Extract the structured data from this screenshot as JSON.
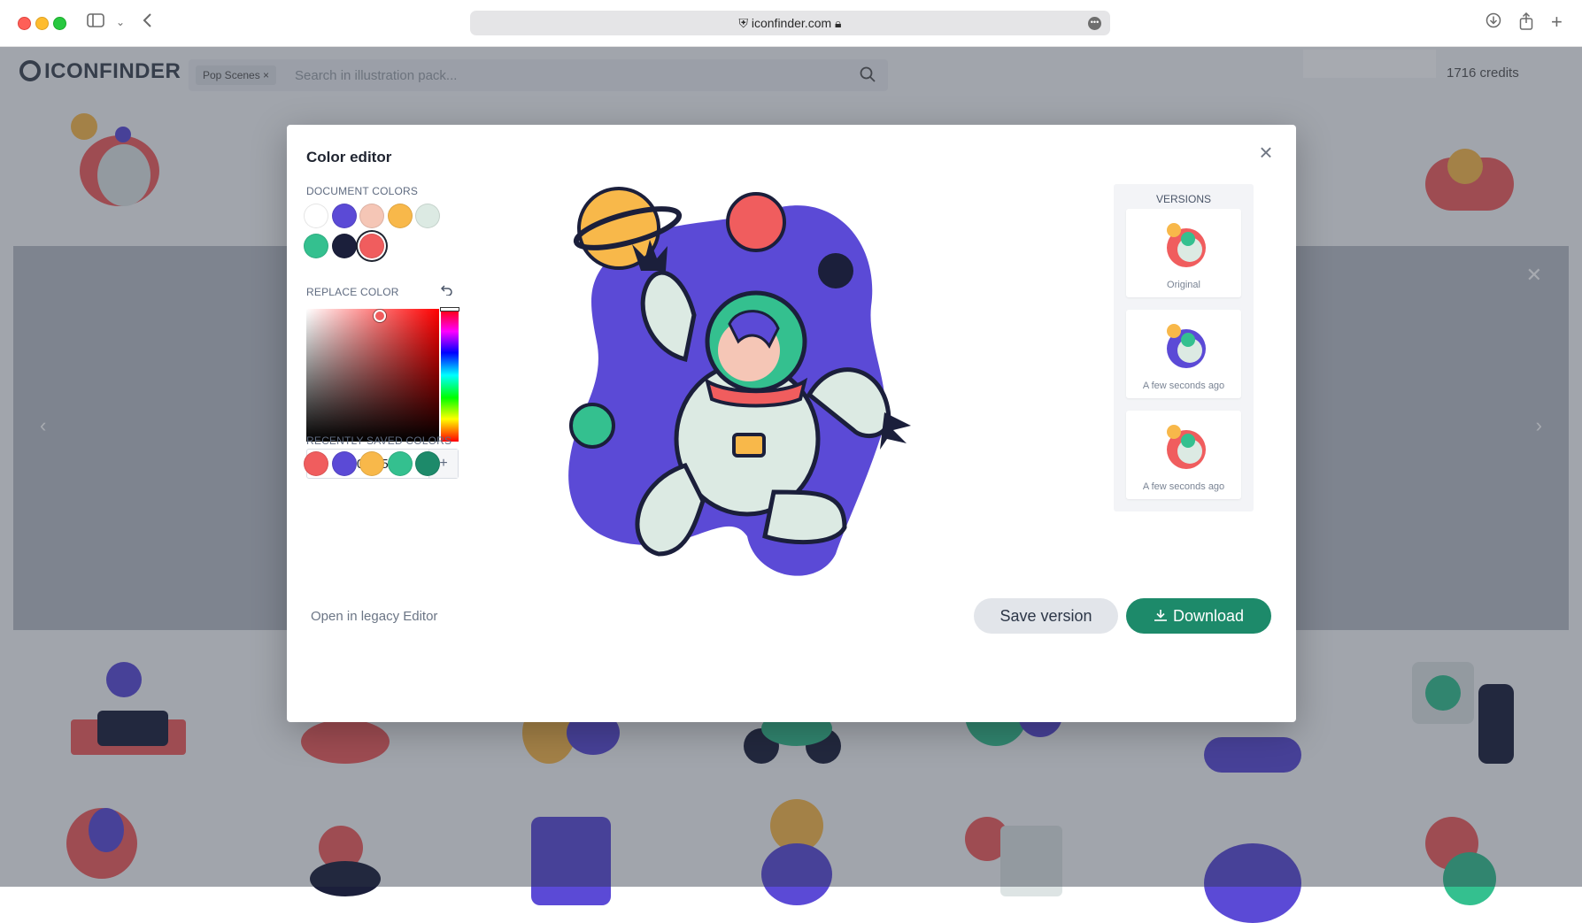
{
  "browser": {
    "url": "iconfinder.com",
    "more_glyph": "•••"
  },
  "site": {
    "logo_text": "ICONFINDER",
    "search_chip": "Pop Scenes ×",
    "search_placeholder": "Search in illustration pack...",
    "credits": "1716 credits"
  },
  "modal": {
    "title": "Color editor",
    "document_colors_label": "DOCUMENT COLORS",
    "document_colors": [
      "#ffffff",
      "#5b4ad6",
      "#f5c6b6",
      "#f8b84a",
      "#dceae3",
      "#34c08f",
      "#1b1f3b",
      "#f05d5e"
    ],
    "selected_color_index": 7,
    "replace_color_label": "REPLACE COLOR",
    "hex_value": "#F05D5E",
    "add_glyph": "+",
    "recent_label": "RECENTLY SAVED COLORS",
    "recent_colors": [
      "#f05d5e",
      "#5b4ad6",
      "#f8b84a",
      "#34c08f",
      "#1d8a6a"
    ],
    "legacy_link": "Open in legacy Editor",
    "versions_label": "VERSIONS",
    "versions": [
      {
        "label": "Original"
      },
      {
        "label": "A few seconds ago"
      },
      {
        "label": "A few seconds ago"
      }
    ],
    "save_label": "Save version",
    "download_label": "Download"
  },
  "colors": {
    "accent_green": "#1d8a6a",
    "purple": "#5b4ad6",
    "red": "#f05d5e"
  }
}
